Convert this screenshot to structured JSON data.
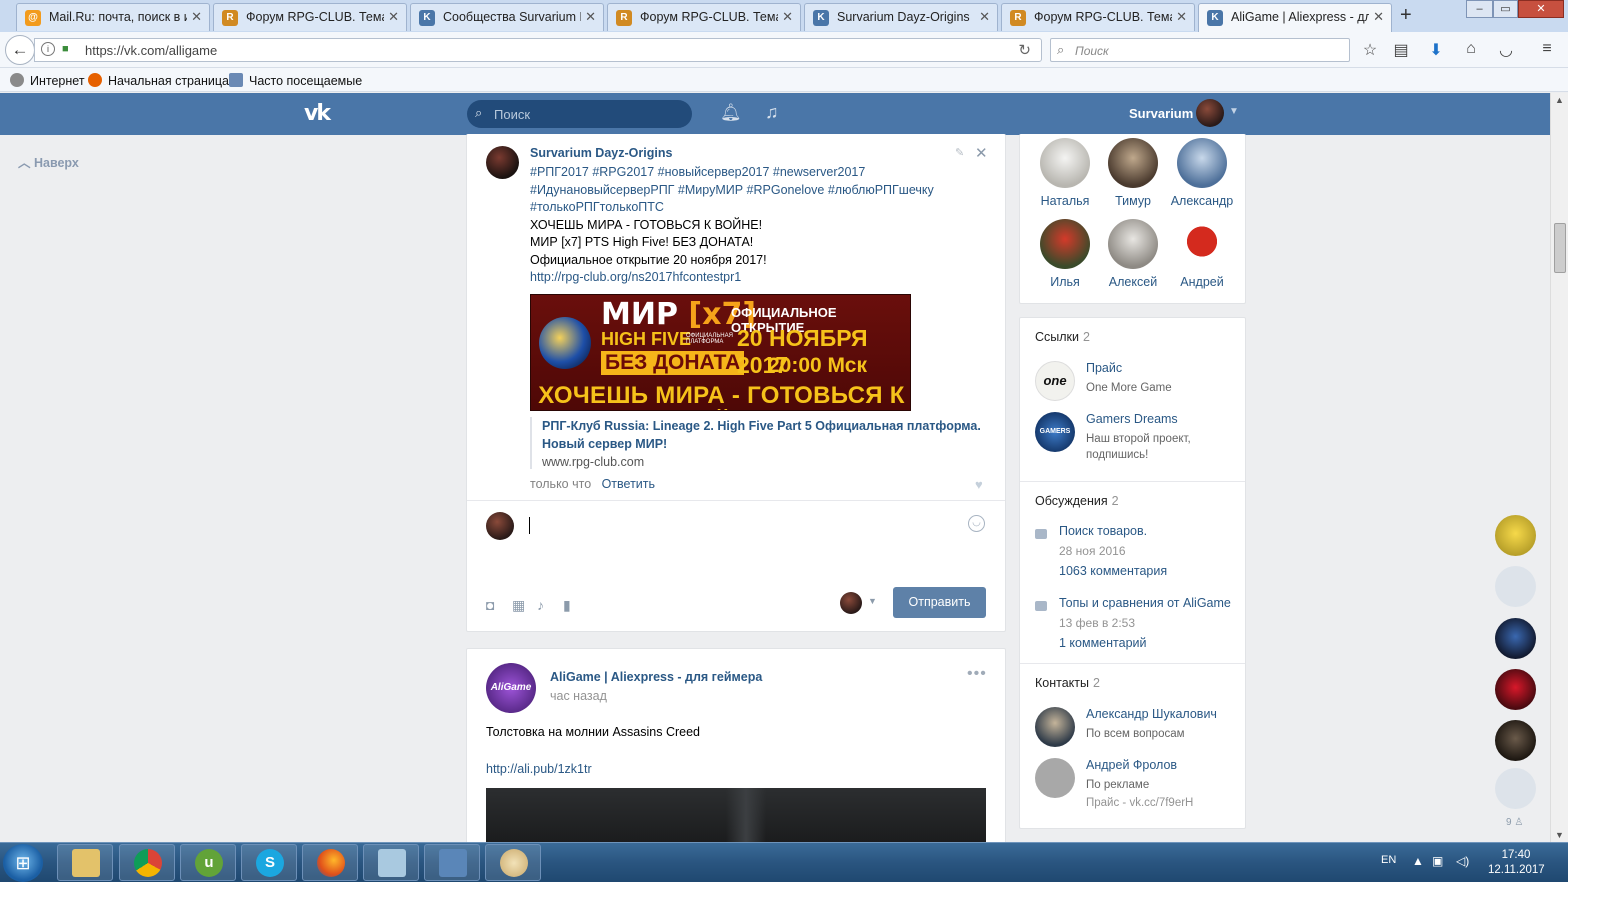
{
  "browser": {
    "tabs": [
      {
        "label": "Mail.Ru: почта, поиск в ин",
        "icon": "mailru-icon"
      },
      {
        "label": "Форум RPG-CLUB. Тема: R",
        "icon": "rpgclub-icon"
      },
      {
        "label": "Сообщества Survarium Da",
        "icon": "vk-icon"
      },
      {
        "label": "Форум RPG-CLUB. Тема: N",
        "icon": "rpgclub-icon"
      },
      {
        "label": "Survarium Dayz-Origins",
        "icon": "vk-icon"
      },
      {
        "label": "Форум RPG-CLUB. Тема: N",
        "icon": "rpgclub-icon"
      },
      {
        "label": "AliGame | Aliexpress - для г",
        "icon": "vk-icon",
        "active": true
      }
    ],
    "url": "https://vk.com/alligame",
    "search_placeholder": "Поиск",
    "bookmarks": [
      "Интернет",
      "Начальная страница",
      "Часто посещаемые"
    ]
  },
  "vk": {
    "logo": "vk",
    "search_placeholder": "Поиск",
    "username": "Survarium",
    "back_to_top": "Наверх"
  },
  "post1": {
    "author": "Survarium Dayz-Origins",
    "tags": "#РПГ2017 #RPG2017 #новыйсервер2017 #newserver2017 #ИдунановыйсерверРПГ #МируМИР #RPGonelove #люблюРПГшечку #толькоРПГтолькоПТС",
    "lines": [
      "ХОЧЕШЬ МИРА - ГОТОВЬСЯ К ВОЙНЕ!",
      "МИР [x7] PTS High Five! БЕЗ ДОНАТА!",
      "Официальное открытие 20 ноября 2017!"
    ],
    "link": "http://rpg-club.org/ns2017hfcontestpr1",
    "banner": {
      "title": "МИР",
      "rate": "[x7]",
      "subtitle": "HIGH FIVE",
      "platform": "ОФИЦИАЛЬНАЯ ПЛАТФОРМА",
      "nodonate": "БЕЗ ДОНАТА",
      "opening": "ОФИЦИАЛЬНОЕ ОТКРЫТИЕ",
      "date": "20 НОЯБРЯ 2017",
      "time": "20:00 Мск",
      "slogan": "ХОЧЕШЬ МИРА - ГОТОВЬСЯ К ВОЙНЕ"
    },
    "snippet_title": "РПГ-Клуб Russia: Lineage 2. High Five Part 5 Официальная платформа. Новый сервер МИР!",
    "snippet_url": "www.rpg-club.com",
    "time": "только что",
    "reply": "Ответить",
    "send": "Отправить"
  },
  "post2": {
    "author": "AliGame | Aliexpress - для геймера",
    "avatar_text": "AliGame",
    "time": "час назад",
    "text": "Толстовка на молнии Assasins Creed",
    "link": "http://ali.pub/1zk1tr"
  },
  "friends": [
    {
      "name": "Наталья"
    },
    {
      "name": "Тимур"
    },
    {
      "name": "Александр"
    },
    {
      "name": "Илья"
    },
    {
      "name": "Алексей"
    },
    {
      "name": "Андрей"
    }
  ],
  "links": {
    "title": "Ссылки",
    "count": "2",
    "items": [
      {
        "title": "Прайс",
        "desc": "One More Game",
        "avatar_text": "one"
      },
      {
        "title": "Gamers Dreams",
        "desc": "Наш второй проект, подпишись!",
        "avatar_text": "GAMERS"
      }
    ]
  },
  "discussions": {
    "title": "Обсуждения",
    "count": "2",
    "items": [
      {
        "title": "Поиск товаров.",
        "date": "28 ноя 2016",
        "comments": "1063 комментария"
      },
      {
        "title": "Топы и сравнения от AliGame",
        "date": "13 фев в 2:53",
        "comments": "1 комментарий"
      }
    ]
  },
  "contacts": {
    "title": "Контакты",
    "count": "2",
    "items": [
      {
        "name": "Александр Шукалович",
        "role": "По всем вопросам"
      },
      {
        "name": "Андрей Фролов",
        "role": "По рекламе",
        "extra": "Прайс - vk.cc/7f9erH"
      }
    ]
  },
  "chats_count": "9",
  "taskbar": {
    "lang": "EN",
    "time": "17:40",
    "date": "12.11.2017"
  },
  "colors": {
    "vk_blue": "#4a76a8",
    "link": "#2a5885",
    "button": "#5e81a8"
  }
}
